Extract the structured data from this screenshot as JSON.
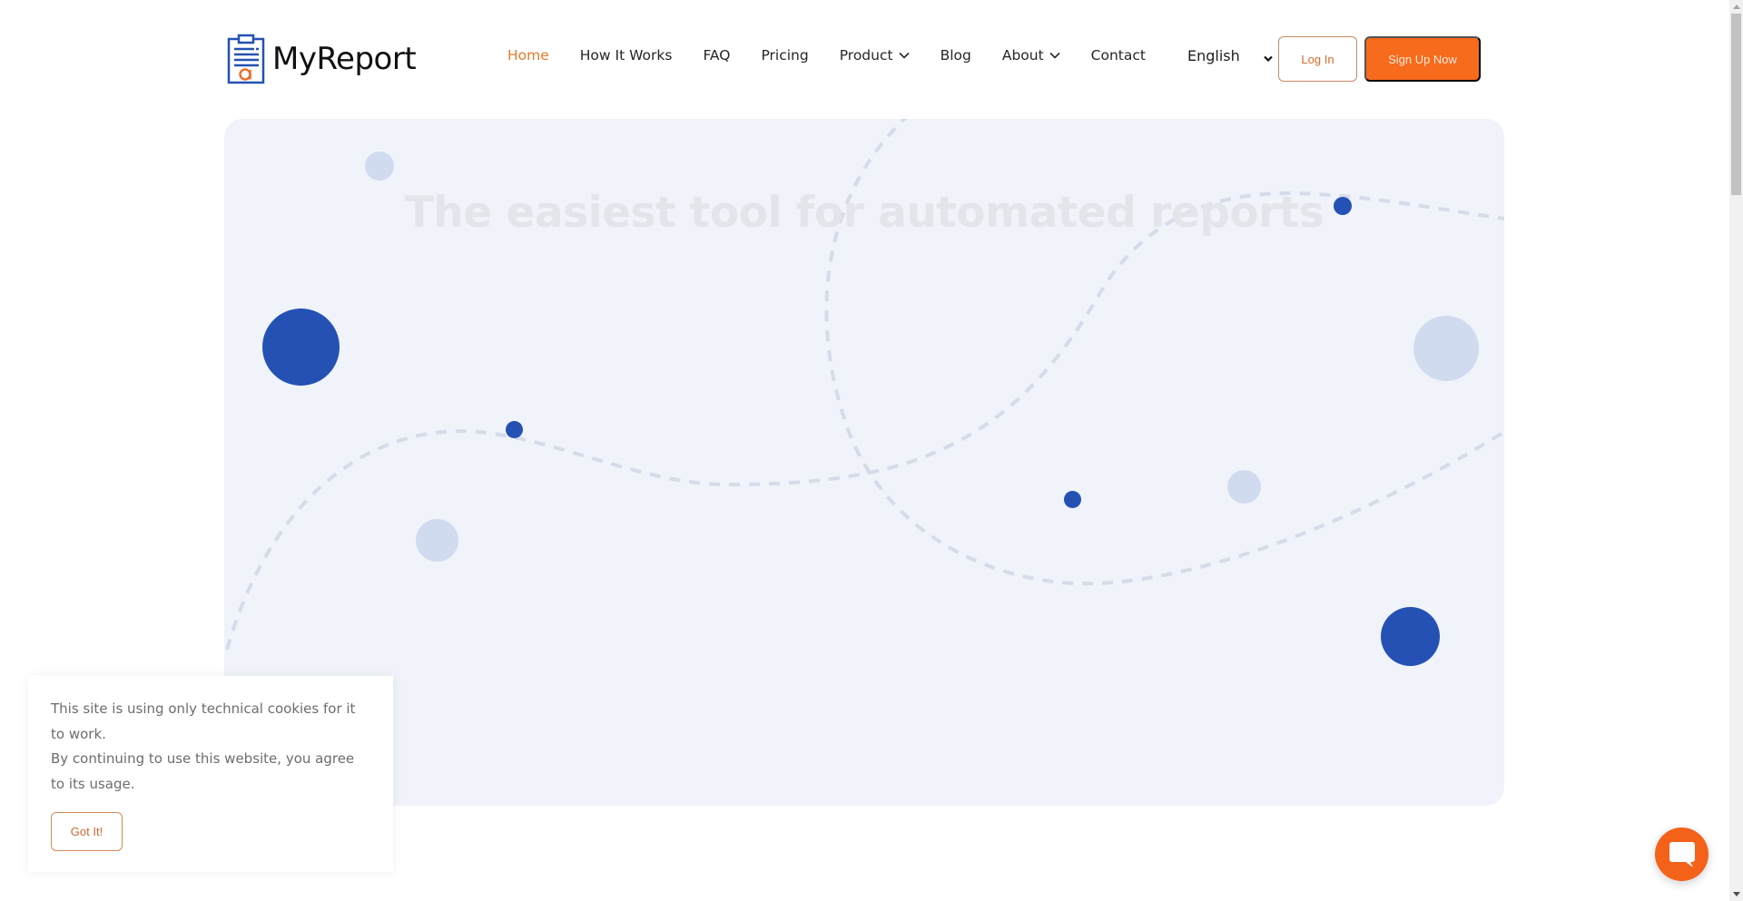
{
  "brand": {
    "name": "MyReport",
    "icon": "clipboard-report-icon",
    "accent_color": "#f76b1c",
    "primary_blue": "#2451b3"
  },
  "nav": {
    "items": [
      {
        "label": "Home",
        "active": true,
        "has_dropdown": false
      },
      {
        "label": "How It Works",
        "active": false,
        "has_dropdown": false
      },
      {
        "label": "FAQ",
        "active": false,
        "has_dropdown": false
      },
      {
        "label": "Pricing",
        "active": false,
        "has_dropdown": false
      },
      {
        "label": "Product",
        "active": false,
        "has_dropdown": true
      },
      {
        "label": "Blog",
        "active": false,
        "has_dropdown": false
      },
      {
        "label": "About",
        "active": false,
        "has_dropdown": true
      },
      {
        "label": "Contact",
        "active": false,
        "has_dropdown": false
      }
    ]
  },
  "language": {
    "selected": "English",
    "icon": "chevron-down-icon"
  },
  "auth": {
    "login_label": "Log In",
    "signup_label": "Sign Up Now"
  },
  "hero": {
    "title": "The easiest tool for automated reports",
    "background_color": "#f0f3fa"
  },
  "cookie_banner": {
    "line1": "This site is using only technical cookies for it to work.",
    "line2": "By continuing to use this website, you agree to its usage.",
    "button_label": "Got It!"
  },
  "chat_widget": {
    "icon": "chat-bubble-icon",
    "color": "#f4621a"
  }
}
